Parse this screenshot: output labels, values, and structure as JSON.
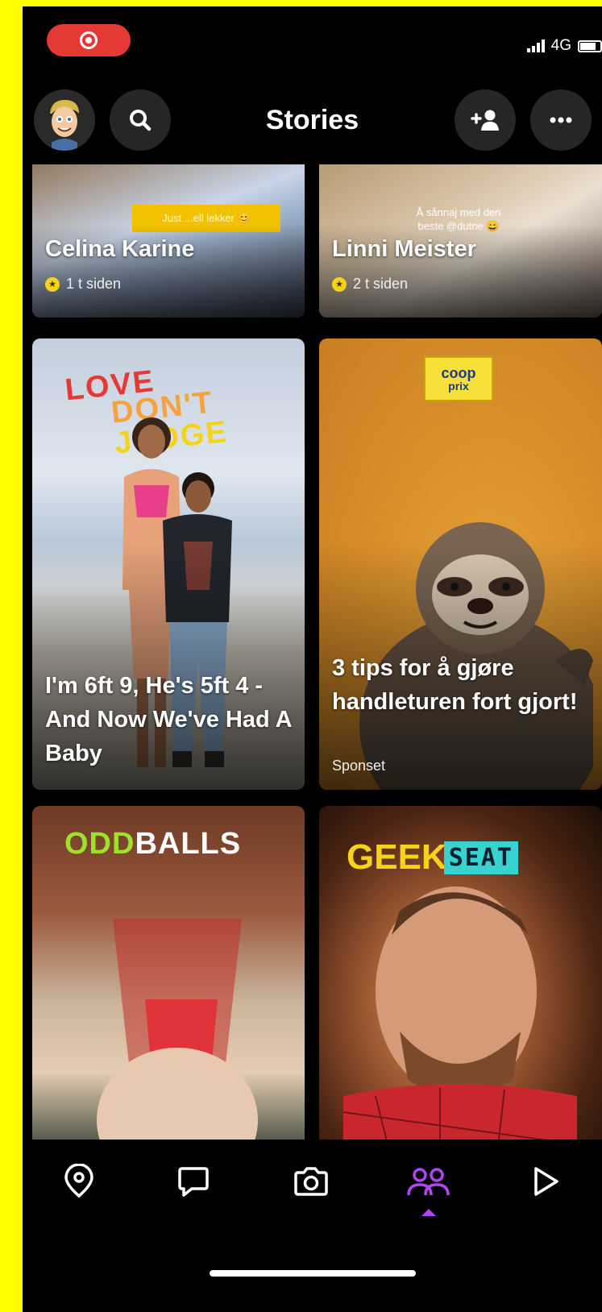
{
  "status_bar": {
    "network": "4G"
  },
  "header": {
    "title": "Stories"
  },
  "stories": [
    {
      "title": "Celina Karine",
      "meta": "1 t siden",
      "sticker": "Just ...ell lekker 😊"
    },
    {
      "title": "Linni Meister",
      "meta": "2 t siden",
      "sticker": "Å sånnaj med den beste @dutne 😄"
    },
    {
      "title": "I'm 6ft 9, He's 5ft 4 - And Now We've Had A Baby",
      "logo_1": "LOVE",
      "logo_2": "DON'T",
      "logo_3": "JUDGE"
    },
    {
      "title": "3 tips for å gjøre handleturen fort gjort!",
      "meta": "Sponset",
      "logo_a": "coop",
      "logo_b": "prix"
    },
    {
      "title": "",
      "logo_1": "ODD",
      "logo_2": "BALLS"
    },
    {
      "title": "",
      "logo_1": "GEEK",
      "logo_2": "SEAT"
    }
  ],
  "nav": {
    "items": [
      "map-icon",
      "chat-icon",
      "camera-icon",
      "stories-icon",
      "spotlight-icon"
    ],
    "active": "stories-icon",
    "active_color": "#b146f0"
  },
  "colors": {
    "background": "#000000",
    "record": "#e53935"
  }
}
